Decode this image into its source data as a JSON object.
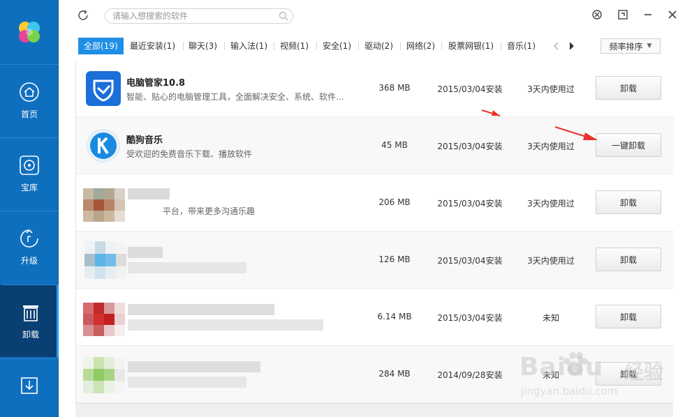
{
  "sidebar": {
    "items": [
      {
        "label": "首页",
        "icon": "home-icon"
      },
      {
        "label": "宝库",
        "icon": "disc-icon"
      },
      {
        "label": "升级",
        "icon": "upgrade-icon"
      },
      {
        "label": "卸载",
        "icon": "trash-icon",
        "active": true
      },
      {
        "label": "",
        "icon": "download-icon"
      }
    ]
  },
  "search": {
    "placeholder": "请输入想搜索的软件"
  },
  "tabs": [
    {
      "label": "全部(19)",
      "active": true
    },
    {
      "label": "最近安装(1)"
    },
    {
      "label": "聊天(3)"
    },
    {
      "label": "输入法(1)"
    },
    {
      "label": "视频(1)"
    },
    {
      "label": "安全(1)"
    },
    {
      "label": "驱动(2)"
    },
    {
      "label": "网络(2)"
    },
    {
      "label": "股票网银(1)"
    },
    {
      "label": "音乐(1)"
    }
  ],
  "sort": {
    "label": "频率排序"
  },
  "apps": [
    {
      "name": "电脑管家10.8",
      "desc": "智能、贴心的电脑管理工具，全面解决安全、系统、软件...",
      "size": "368 MB",
      "date": "2015/03/04安装",
      "usage": "3天内使用过",
      "button": "卸载"
    },
    {
      "name": "酷狗音乐",
      "desc": "受欢迎的免费音乐下载、播放软件",
      "size": "45 MB",
      "date": "2015/03/04安装",
      "usage": "3天内使用过",
      "button": "一键卸载"
    },
    {
      "name": "",
      "desc": "平台，带来更多沟通乐趣",
      "size": "206 MB",
      "date": "2015/03/04安装",
      "usage": "3天内使用过",
      "button": "卸载"
    },
    {
      "name": "",
      "desc": "",
      "size": "126 MB",
      "date": "2015/03/04安装",
      "usage": "3天内使用过",
      "button": "卸载"
    },
    {
      "name": "",
      "desc": "",
      "size": "6.14 MB",
      "date": "2015/03/04安装",
      "usage": "未知",
      "button": "卸载"
    },
    {
      "name": "",
      "desc": "",
      "size": "284 MB",
      "date": "2014/09/28安装",
      "usage": "未知",
      "button": "卸载"
    }
  ],
  "watermark": {
    "brand": "Baidu",
    "brand_cn": "经验",
    "url": "jingyan.baidu.com"
  },
  "colors": {
    "sidebar": "#0f6fbf",
    "sidebar_active": "#0a3f73",
    "tab_active": "#1f8fe5",
    "annotation_arrow": "#e8342c"
  }
}
